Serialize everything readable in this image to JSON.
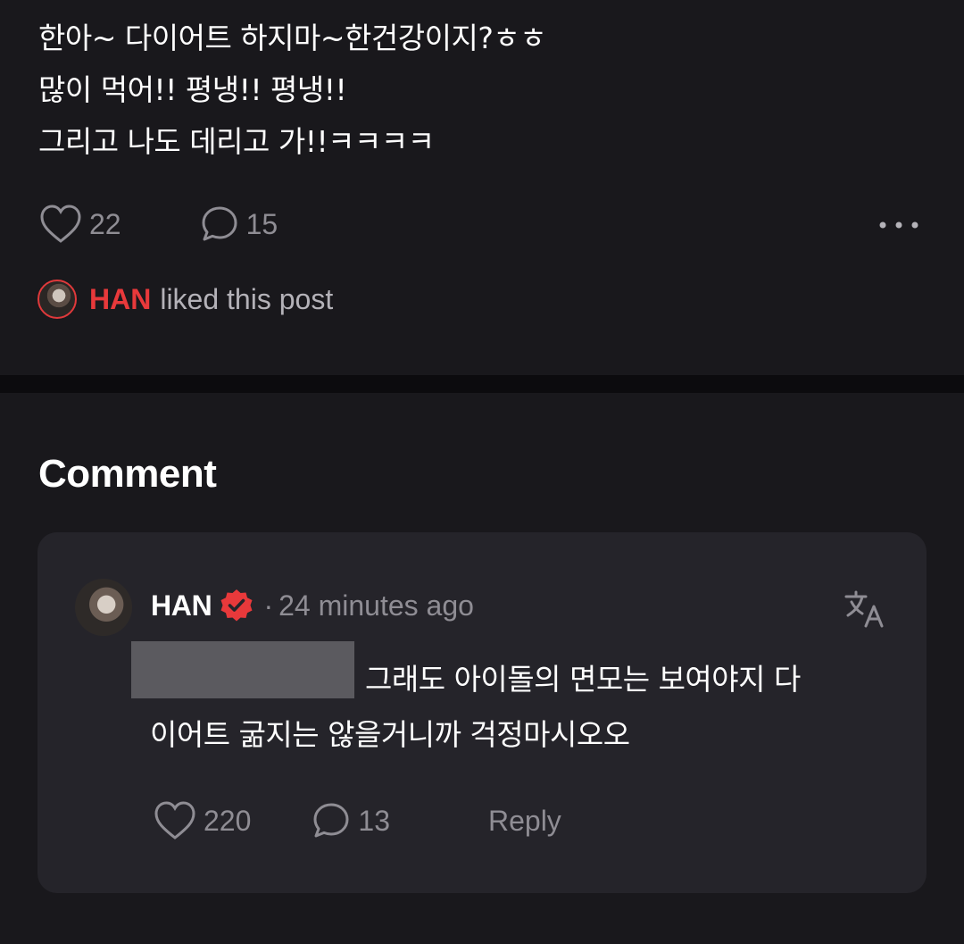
{
  "post": {
    "lines": [
      "한아~ 다이어트 하지마~한건강이지?ㅎㅎ",
      "많이 먹어!! 평냉!! 평냉!!",
      "그리고 나도 데리고 가!!ㅋㅋㅋㅋ"
    ],
    "like_count": "22",
    "comment_count": "15",
    "icons": {
      "like": "heart-outline-icon",
      "comment": "speech-bubble-icon",
      "more": "more-horizontal-icon"
    }
  },
  "liked_by": {
    "name": "HAN",
    "text": "liked this post"
  },
  "comments_section": {
    "heading": "Comment"
  },
  "comment": {
    "author": "HAN",
    "separator": "·",
    "time": "24 minutes ago",
    "text_line1": "그래도 아이돌의 면모는 보여야지 다",
    "text_line2": "이어트 굶지는 않을거니까 걱정마시오오",
    "like_count": "220",
    "reply_count": "13",
    "reply_label": "Reply",
    "icons": {
      "verified": "verified-badge-icon",
      "translate": "translate-icon"
    }
  },
  "colors": {
    "background": "#19181c",
    "card": "#25242a",
    "accent_red": "#e8393b",
    "muted_text": "#8f8d94"
  }
}
